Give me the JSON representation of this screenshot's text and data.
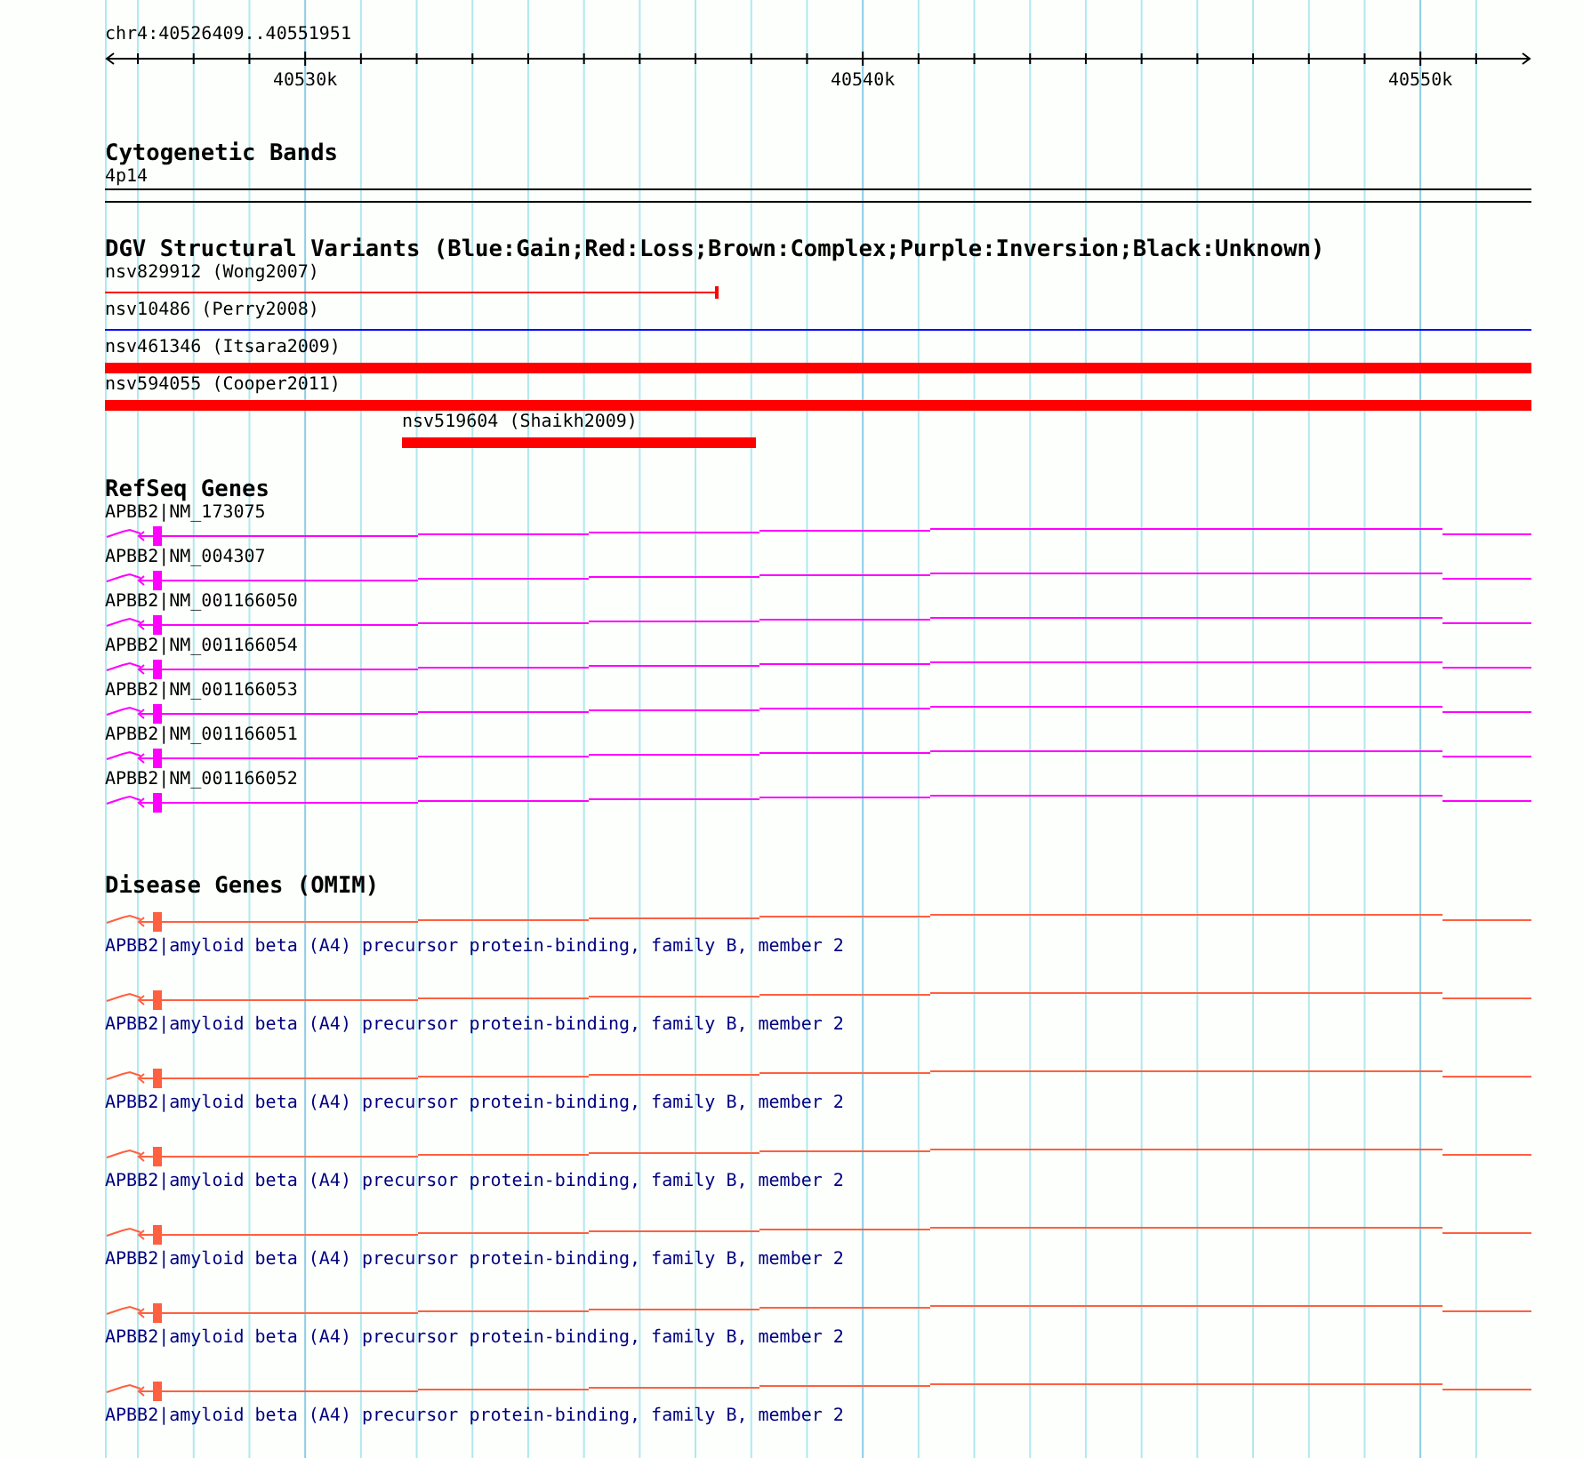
{
  "ruler": {
    "title": "chr4:40526409..40551951",
    "ticks": [
      "40530k",
      "40540k",
      "40550k"
    ]
  },
  "cytogenetic_bands": {
    "title": "Cytogenetic Bands",
    "band": "4p14"
  },
  "dgv_variants": {
    "title": "DGV Structural Variants (Blue:Gain;Red:Loss;Brown:Complex;Purple:Inversion;Black:Unknown)",
    "items": [
      {
        "label": "nsv829912 (Wong2007)",
        "kind": "line",
        "color": "#ff0000"
      },
      {
        "label": "nsv10486 (Perry2008)",
        "kind": "line",
        "color": "#0000ff"
      },
      {
        "label": "nsv461346 (Itsara2009)",
        "kind": "bar",
        "color": "#ff0000"
      },
      {
        "label": "nsv594055 (Cooper2011)",
        "kind": "bar",
        "color": "#ff0000"
      },
      {
        "label": "nsv519604 (Shaikh2009)",
        "kind": "bar",
        "color": "#ff0000"
      }
    ]
  },
  "refseq_genes": {
    "title": "RefSeq Genes",
    "items": [
      {
        "label": "APBB2|NM_173075"
      },
      {
        "label": "APBB2|NM_004307"
      },
      {
        "label": "APBB2|NM_001166050"
      },
      {
        "label": "APBB2|NM_001166054"
      },
      {
        "label": "APBB2|NM_001166053"
      },
      {
        "label": "APBB2|NM_001166051"
      },
      {
        "label": "APBB2|NM_001166052"
      }
    ]
  },
  "disease_genes": {
    "title": "Disease Genes (OMIM)",
    "items": [
      {
        "label": "APBB2|amyloid beta (A4) precursor protein-binding, family B, member 2"
      },
      {
        "label": "APBB2|amyloid beta (A4) precursor protein-binding, family B, member 2"
      },
      {
        "label": "APBB2|amyloid beta (A4) precursor protein-binding, family B, member 2"
      },
      {
        "label": "APBB2|amyloid beta (A4) precursor protein-binding, family B, member 2"
      },
      {
        "label": "APBB2|amyloid beta (A4) precursor protein-binding, family B, member 2"
      },
      {
        "label": "APBB2|amyloid beta (A4) precursor protein-binding, family B, member 2"
      },
      {
        "label": "APBB2|amyloid beta (A4) precursor protein-binding, family B, member 2"
      }
    ]
  }
}
